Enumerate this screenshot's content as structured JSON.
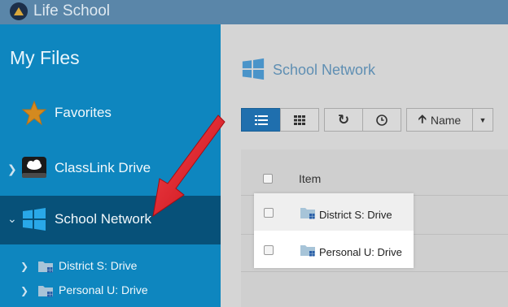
{
  "app": {
    "title": "Life School"
  },
  "sidebar": {
    "title": "My Files",
    "items": [
      {
        "label": "Favorites",
        "icon": "star-icon"
      },
      {
        "label": "ClassLink Drive",
        "icon": "cloud-drive-icon"
      },
      {
        "label": "School Network",
        "icon": "windows-icon",
        "active": true
      }
    ],
    "subitems": [
      {
        "label": "District S: Drive",
        "icon": "network-folder-icon"
      },
      {
        "label": "Personal U: Drive",
        "icon": "network-folder-icon"
      }
    ]
  },
  "main": {
    "title": "School Network",
    "toolbar": {
      "sort_label": "Name"
    },
    "table": {
      "column_item": "Item",
      "rows": [
        {
          "label": "District S: Drive"
        },
        {
          "label": "Personal U: Drive"
        }
      ]
    }
  },
  "colors": {
    "sidebar": "#0e86bf",
    "sidebar_active": "#075179",
    "accent": "#1f6fae",
    "arrow": "#e3121b"
  }
}
